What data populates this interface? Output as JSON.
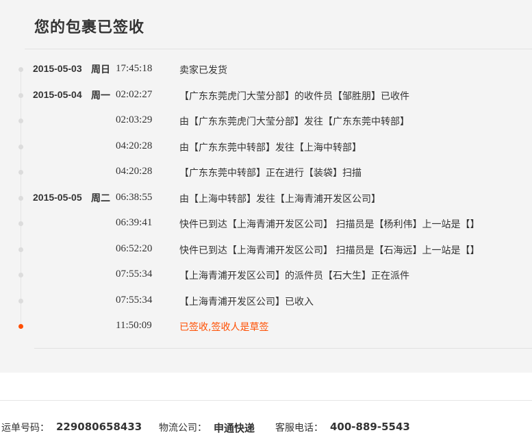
{
  "header": {
    "title": "您的包裹已签收"
  },
  "timeline": [
    {
      "date": "2015-05-03",
      "weekday": "周日",
      "time": "17:45:18",
      "desc": "卖家已发货",
      "active": false
    },
    {
      "date": "2015-05-04",
      "weekday": "周一",
      "time": "02:02:27",
      "desc": "【广东东莞虎门大莹分部】的收件员【邹胜朋】已收件",
      "active": false
    },
    {
      "date": "",
      "weekday": "",
      "time": "02:03:29",
      "desc": "由【广东东莞虎门大莹分部】发往【广东东莞中转部】",
      "active": false
    },
    {
      "date": "",
      "weekday": "",
      "time": "04:20:28",
      "desc": "由【广东东莞中转部】发往【上海中转部】",
      "active": false
    },
    {
      "date": "",
      "weekday": "",
      "time": "04:20:28",
      "desc": "【广东东莞中转部】正在进行【装袋】扫描",
      "active": false
    },
    {
      "date": "2015-05-05",
      "weekday": "周二",
      "time": "06:38:55",
      "desc": "由【上海中转部】发往【上海青浦开发区公司】",
      "active": false
    },
    {
      "date": "",
      "weekday": "",
      "time": "06:39:41",
      "desc": "快件已到达【上海青浦开发区公司】 扫描员是【杨利伟】上一站是【】",
      "active": false
    },
    {
      "date": "",
      "weekday": "",
      "time": "06:52:20",
      "desc": "快件已到达【上海青浦开发区公司】 扫描员是【石海远】上一站是【】",
      "active": false
    },
    {
      "date": "",
      "weekday": "",
      "time": "07:55:34",
      "desc": "【上海青浦开发区公司】的派件员【石大生】正在派件",
      "active": false
    },
    {
      "date": "",
      "weekday": "",
      "time": "07:55:34",
      "desc": "【上海青浦开发区公司】已收入",
      "active": false
    },
    {
      "date": "",
      "weekday": "",
      "time": "11:50:09",
      "desc": "已签收,签收人是草签",
      "active": true
    }
  ],
  "footer": {
    "waybill_label": "运单号码：",
    "waybill_value": "229080658433",
    "company_label": "物流公司：",
    "company_value": "申通快递",
    "phone_label": "客服电话：",
    "phone_value": "400-889-5543"
  },
  "colors": {
    "accent": "#ff4e00",
    "panel_bg": "#f4f4f4",
    "text": "#333333"
  }
}
